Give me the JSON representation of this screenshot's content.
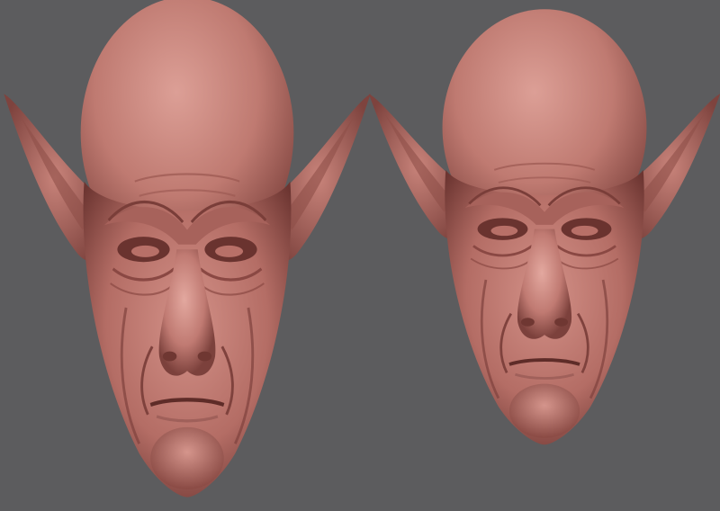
{
  "scene": {
    "background_color": "#5c5c5e",
    "clay_color": "#c07a72",
    "clay_shadow_color": "#6e3a36",
    "clay_highlight_color": "#e0a59c",
    "subjects": [
      {
        "name": "sculpted-head-left",
        "expression": "frowning"
      },
      {
        "name": "sculpted-head-right",
        "expression": "frowning"
      }
    ]
  }
}
